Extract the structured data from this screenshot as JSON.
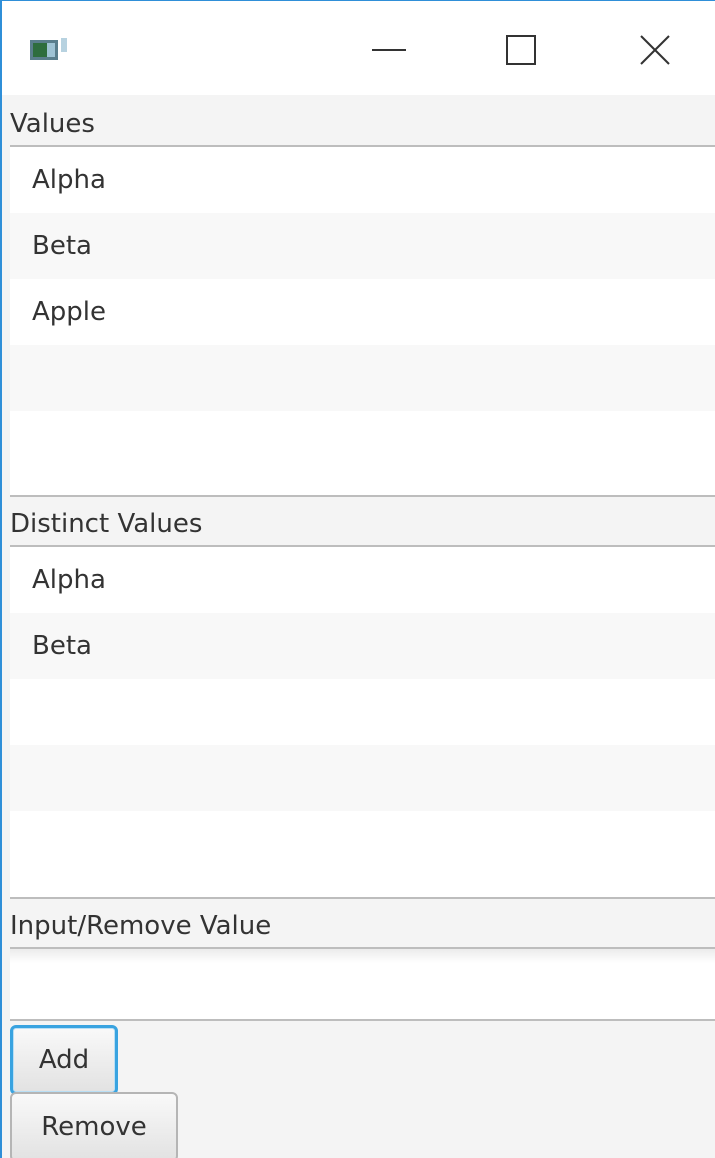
{
  "window": {
    "icon": "java-app-icon",
    "controls": {
      "minimize": "minimize-icon",
      "maximize": "maximize-icon",
      "close": "close-icon"
    }
  },
  "values_section": {
    "label": "Values",
    "items": [
      "Alpha",
      "Beta",
      "Apple",
      "",
      ""
    ]
  },
  "distinct_section": {
    "label": "Distinct Values",
    "items": [
      "Alpha",
      "Beta",
      "",
      "",
      ""
    ]
  },
  "input_section": {
    "label": "Input/Remove Value",
    "value": "",
    "placeholder": ""
  },
  "buttons": {
    "add": "Add",
    "remove": "Remove"
  },
  "colors": {
    "focus_accent": "#39a3e0",
    "window_border": "#2f8fd8"
  }
}
